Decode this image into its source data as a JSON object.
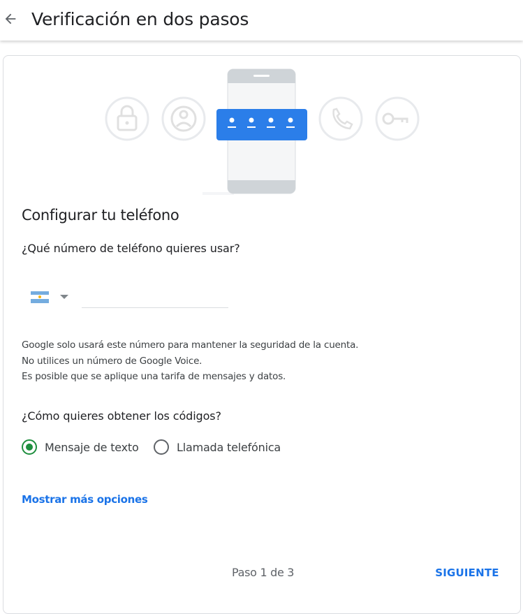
{
  "header": {
    "back_icon": "arrow-back-icon",
    "title": "Verificación en dos pasos"
  },
  "illustration": {
    "icons": [
      "lock-icon",
      "account-circle-icon",
      "phone-handset-icon",
      "key-icon"
    ],
    "code_card_color": "#1a73e8"
  },
  "main": {
    "section_title": "Configurar tu teléfono",
    "phone_question": "¿Qué número de teléfono quieres usar?",
    "country_flag": "argentina-flag-icon",
    "phone_value": "",
    "info_lines": [
      "Google solo usará este número para mantener la seguridad de la cuenta.",
      "No utilices un número de Google Voice.",
      "Es posible que se aplique una tarifa de mensajes y datos."
    ],
    "codes_question": "¿Cómo quieres obtener los códigos?",
    "options": [
      {
        "label": "Mensaje de texto",
        "selected": true
      },
      {
        "label": "Llamada telefónica",
        "selected": false
      }
    ],
    "more_options": "Mostrar más opciones"
  },
  "footer": {
    "step": "Paso 1 de 3",
    "next_label": "SIGUIENTE"
  },
  "colors": {
    "accent": "#1a73e8",
    "radio_selected": "#1e8e3e"
  }
}
